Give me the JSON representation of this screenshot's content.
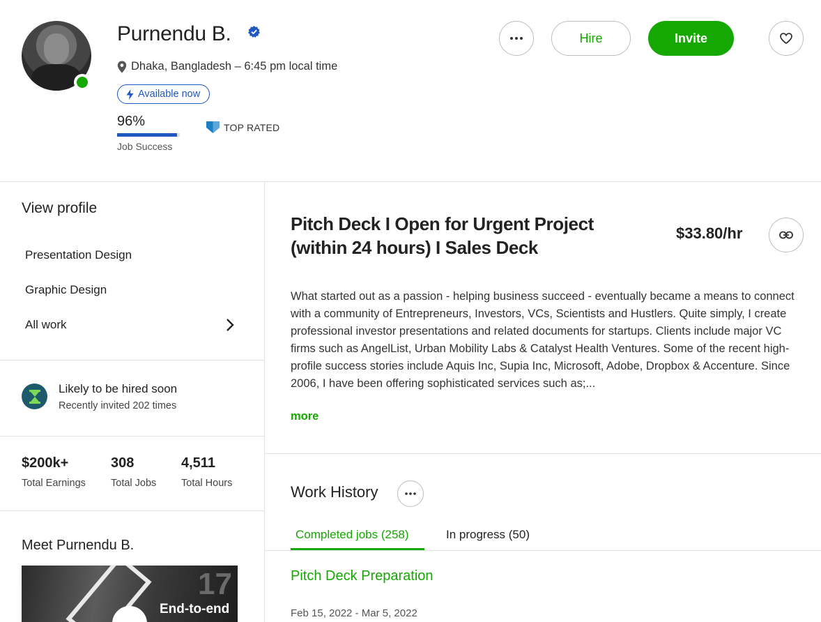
{
  "profile": {
    "name": "Purnendu B.",
    "location": "Dhaka, Bangladesh – 6:45 pm local time",
    "availability": "Available now",
    "job_success_value": "96%",
    "job_success_fraction": 0.96,
    "job_success_label": "Job Success",
    "badge": "TOP RATED"
  },
  "actions": {
    "hire": "Hire",
    "invite": "Invite"
  },
  "sidebar": {
    "title": "View profile",
    "items": [
      {
        "label": "Presentation Design"
      },
      {
        "label": "Graphic Design"
      },
      {
        "label": "All work"
      }
    ],
    "hired": {
      "title": "Likely to be hired soon",
      "subtitle": "Recently invited 202 times"
    },
    "stats": [
      {
        "value": "$200k+",
        "label": "Total Earnings"
      },
      {
        "value": "308",
        "label": "Total Jobs"
      },
      {
        "value": "4,511",
        "label": "Total Hours"
      }
    ],
    "meet": "Meet Purnendu B.",
    "video_text": "End-to-end",
    "video_number": "17"
  },
  "main": {
    "headline": "Pitch Deck I Open for Urgent Project (within 24 hours) I Sales Deck",
    "rate": "$33.80/hr",
    "description": "What started out as a passion - helping business succeed - eventually became a means to connect with a community of Entrepreneurs, Investors, VCs, Scientists and Hustlers. Quite simply, I create professional investor presentations and related documents for startups. Clients include major VC firms such as AngelList, Urban Mobility Labs & Catalyst Health Ventures. Some of the recent high-profile success stories include Aquis Inc, Supia Inc, Microsoft, Adobe, Dropbox & Accenture. Since 2006, I have been offering sophisticated services such as;...",
    "more": "more",
    "work_history": {
      "title": "Work History",
      "tabs": [
        {
          "label": "Completed jobs (258)",
          "active": true
        },
        {
          "label": "In progress (50)",
          "active": false
        }
      ],
      "jobs": [
        {
          "title": "Pitch Deck Preparation",
          "dates": "Feb 15, 2022 - Mar 5, 2022"
        }
      ]
    }
  },
  "colors": {
    "brand_green": "#14a800",
    "accent_blue": "#1f57c3"
  }
}
